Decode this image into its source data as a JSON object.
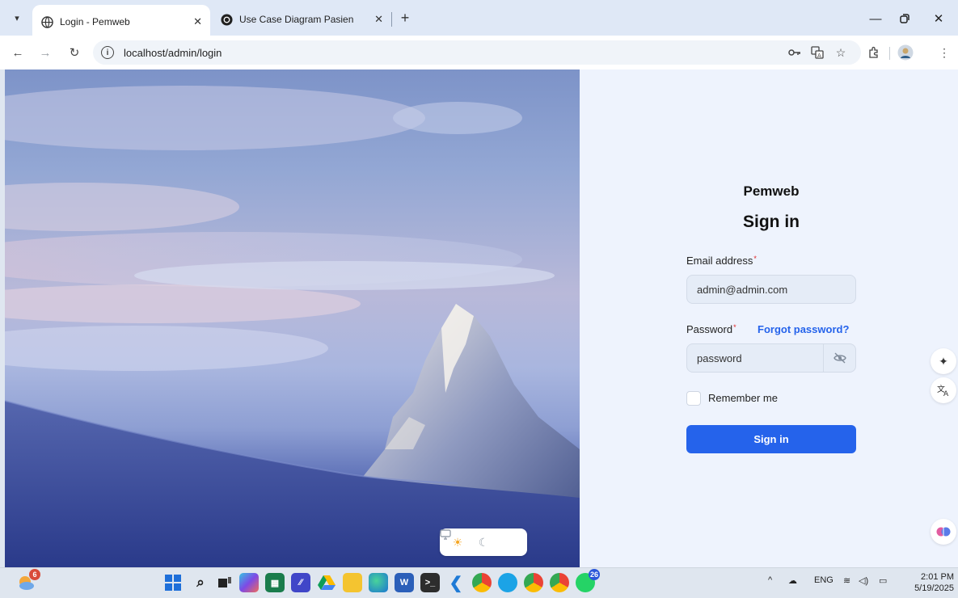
{
  "browser": {
    "tabs": [
      {
        "title": "Login - Pemweb",
        "active": true
      },
      {
        "title": "Use Case Diagram Pasien",
        "active": false
      }
    ],
    "new_tab": "+",
    "url": "localhost/admin/login"
  },
  "login": {
    "brand": "Pemweb",
    "heading": "Sign in",
    "email_label": "Email address",
    "email_value": "admin@admin.com",
    "password_label": "Password",
    "password_value": "password",
    "forgot_label": "Forgot password?",
    "remember_label": "Remember me",
    "remember_checked": false,
    "submit_label": "Sign in",
    "required_mark": "*"
  },
  "theme_switcher": {
    "options": [
      "light",
      "dark",
      "system"
    ],
    "selected": "light"
  },
  "taskbar": {
    "weather_badge": "6",
    "whatsapp_badge": "26",
    "language": "ENG",
    "time": "2:01 PM",
    "date": "5/19/2025"
  },
  "colors": {
    "accent": "#2563eb",
    "panel_bg": "#eef3fd",
    "required": "#e02424"
  }
}
